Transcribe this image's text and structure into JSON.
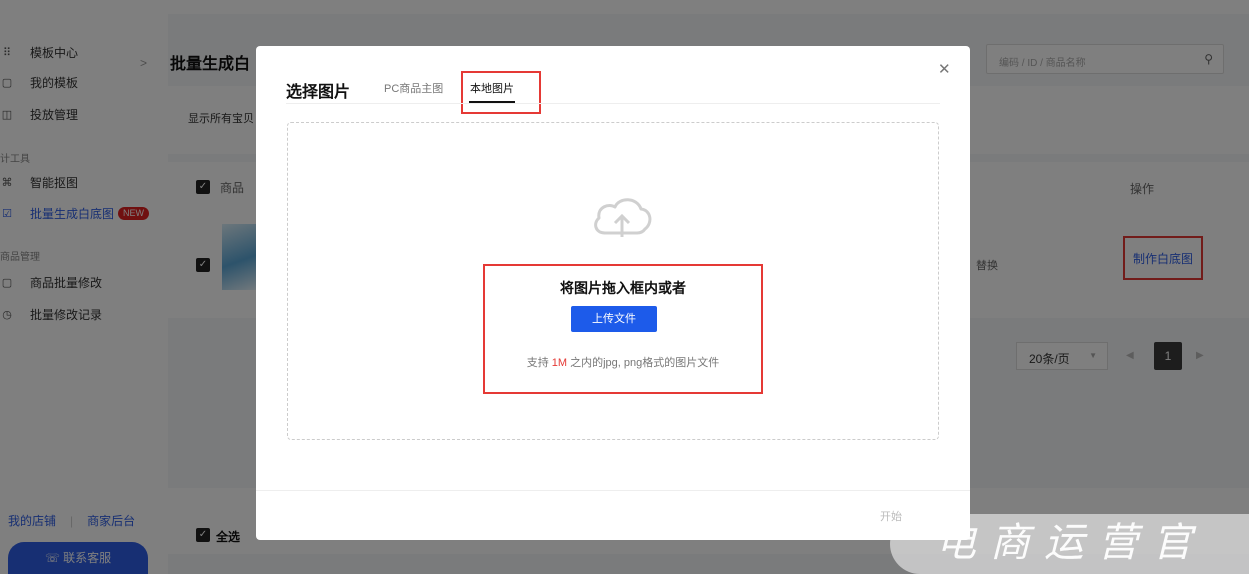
{
  "sidebar": {
    "template_center": "模板中心",
    "my_templates": "我的模板",
    "placement": "投放管理",
    "design_tools_group": "计工具",
    "smart_cutout": "智能抠图",
    "batch_white_bg": "批量生成白底图",
    "new_badge": "NEW",
    "product_mgmt_group": "商品管理",
    "batch_edit": "商品批量修改",
    "batch_edit_log": "批量修改记录",
    "my_store": "我的店铺",
    "merchant_backend": "商家后台",
    "contact_service": "联系客服"
  },
  "main": {
    "page_title": "批量生成白",
    "search_placeholder": "编码 / ID / 商品名称",
    "filter_text": "显示所有宝贝",
    "col_goods": "商品",
    "col_action": "操作",
    "replace_text": "替换",
    "make_white_link": "制作白底图",
    "per_page": "20条/页",
    "current_page": "1",
    "select_all": "全选"
  },
  "modal": {
    "title": "选择图片",
    "tabs": [
      {
        "label": "PC商品主图",
        "active": false
      },
      {
        "label": "本地图片",
        "active": true
      }
    ],
    "drag_text": "将图片拖入框内或者",
    "upload_button": "上传文件",
    "support_prefix": "支持 ",
    "support_size": "1M",
    "support_suffix": " 之内的jpg, png格式的图片文件",
    "footer_button": "开始"
  },
  "watermark": {
    "text": "电商运营官"
  },
  "colors": {
    "primary": "#1d5bea",
    "highlight_box": "#e53935",
    "badge_red": "#e02020"
  }
}
